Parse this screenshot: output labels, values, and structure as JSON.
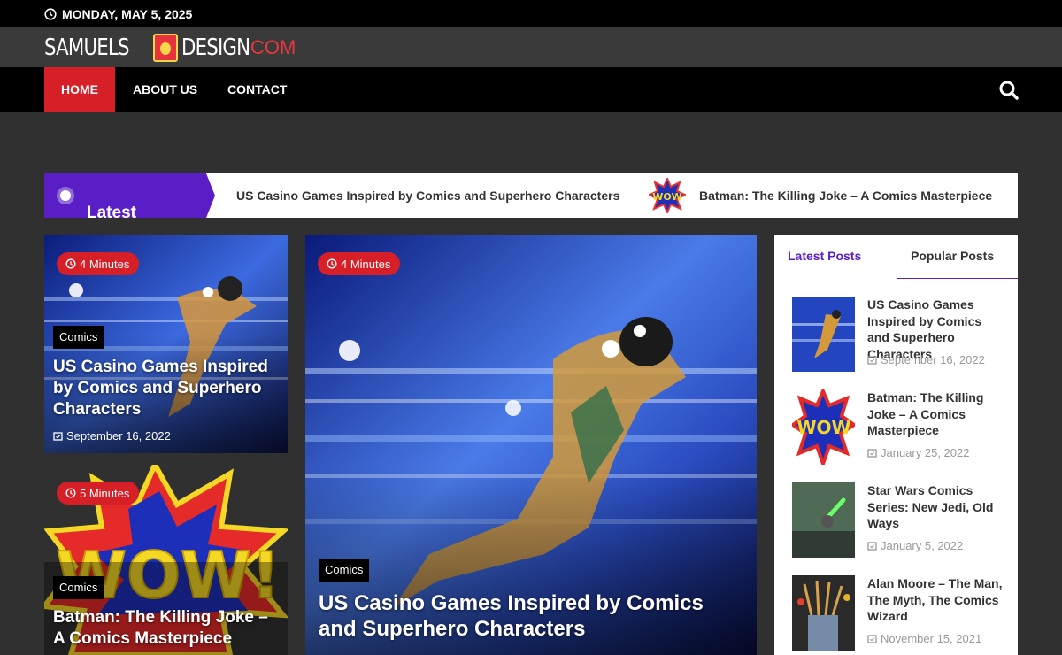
{
  "topbar": {
    "date": "MONDAY, MAY 5, 2025"
  },
  "logo": {
    "left": "SAMUELS",
    "right": "DESIGN",
    "tld": ".COM"
  },
  "nav": {
    "home": "HOME",
    "about": "ABOUT US",
    "contact": "CONTACT"
  },
  "ticker": {
    "label": "Latest News:",
    "items": [
      "US Casino Games Inspired by Comics and Superhero Characters",
      "Batman: The Killing Joke – A Comics Masterpiece"
    ]
  },
  "cards": {
    "small1": {
      "time": "4 Minutes",
      "category": "Comics",
      "title": "US Casino Games Inspired by Comics and Superhero Characters",
      "date": "September 16, 2022"
    },
    "small2": {
      "time": "5 Minutes",
      "category": "Comics",
      "title": "Batman: The Killing Joke – A Comics Masterpiece"
    },
    "big": {
      "time": "4 Minutes",
      "category": "Comics",
      "title": "US Casino Games Inspired by Comics and Superhero Characters"
    }
  },
  "sidebar": {
    "tabs": [
      "Latest Posts",
      "Popular Posts"
    ],
    "posts": [
      {
        "title": "US Casino Games Inspired by Comics and Superhero Characters",
        "date": "September 16, 2022"
      },
      {
        "title": "Batman: The Killing Joke – A Comics Masterpiece",
        "date": "January 25, 2022"
      },
      {
        "title": "Star Wars Comics Series: New Jedi, Old Ways",
        "date": "January 5, 2022"
      },
      {
        "title": "Alan Moore – The Man, The Myth, The Comics Wizard",
        "date": "November 15, 2021"
      }
    ]
  },
  "colors": {
    "accent_red": "#d61f26",
    "accent_purple": "#5a1ec6",
    "body_bg": "#303030"
  }
}
